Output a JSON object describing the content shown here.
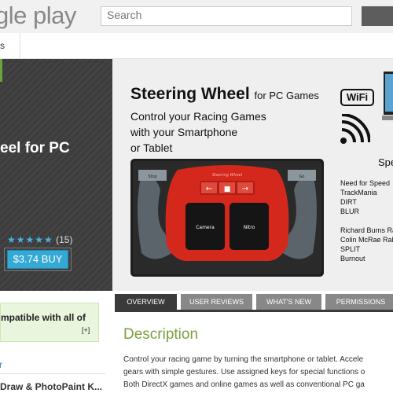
{
  "header": {
    "logo_text": "gle play",
    "search_placeholder": "Search",
    "subnav_tab": "s"
  },
  "app": {
    "title": "eel for PC",
    "rating_count": "(15)",
    "stars": "★★★★★",
    "buy_label": "$3.74 BUY"
  },
  "promo": {
    "title": "Steering Wheel",
    "title_suffix": "for PC Games",
    "subtitle_lines": [
      "Control your Racing Games",
      "with your Smartphone",
      "or Tablet"
    ],
    "wifi_label": "WiFi",
    "spec_label": "Spe",
    "games_group1": [
      "Need for Speed",
      "TrackMania",
      "DIRT",
      "BLUR"
    ],
    "games_group2": [
      "Richard Burns Ra",
      "Colin McRae Rall",
      "SPLIT",
      "Burnout"
    ],
    "wheel": {
      "brand": "Steering Wheel",
      "left_label": "Stop",
      "right_label": "Go",
      "camera_label": "Camera",
      "nitro_label": "Nitro"
    }
  },
  "compat": {
    "text": "mpatible with all of",
    "plus": "[+]"
  },
  "left_links": {
    "more": "r",
    "related_item": "Draw & PhotoPaint K..."
  },
  "tabs": [
    {
      "label": "OVERVIEW",
      "active": true
    },
    {
      "label": "USER REVIEWS",
      "active": false
    },
    {
      "label": "WHAT'S NEW",
      "active": false
    },
    {
      "label": "PERMISSIONS",
      "active": false
    }
  ],
  "description": {
    "heading": "Description",
    "lines": [
      "Control your racing game by turning the smartphone or tablet. Accele",
      "gears with simple gestures. Use assigned keys for special functions o",
      "Both DirectX games and online games as well as conventional PC ga"
    ]
  },
  "colors": {
    "accent_green": "#7ba03d",
    "buy_blue": "#33a9d4",
    "star_blue": "#4ab1e1",
    "wheel_red": "#d4281c"
  }
}
